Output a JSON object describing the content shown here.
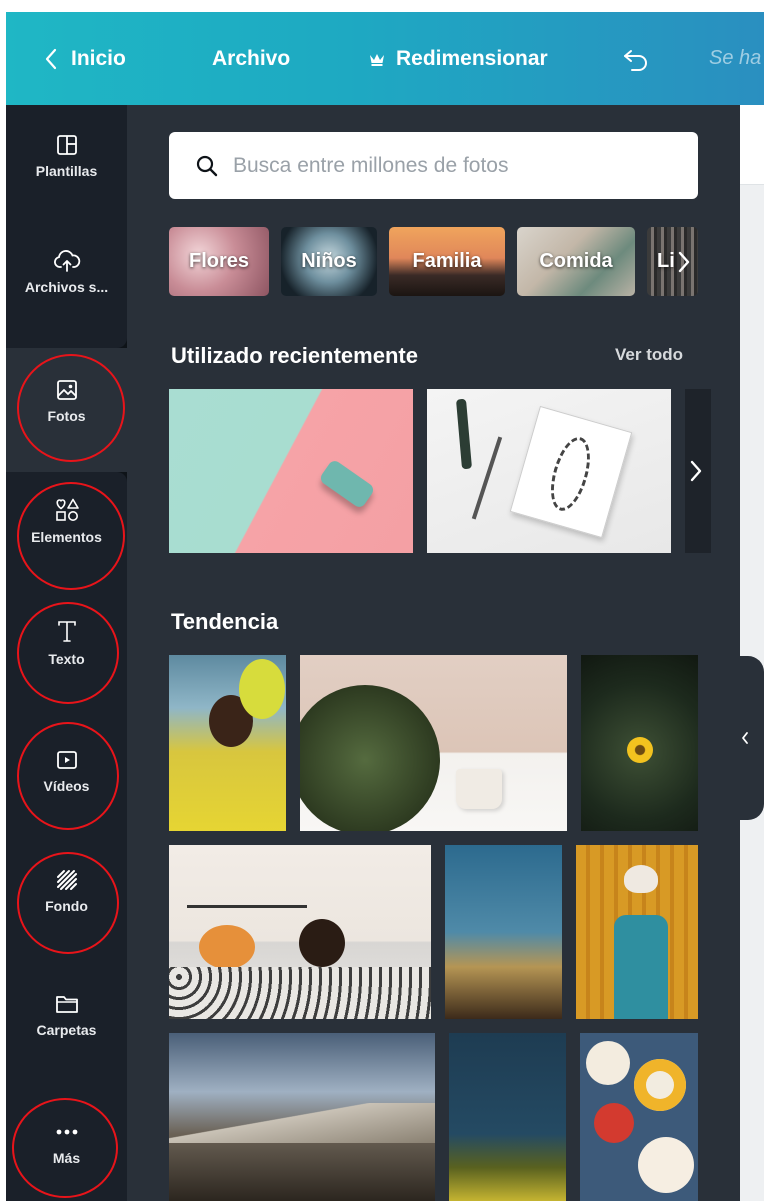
{
  "topbar": {
    "back_label": "Inicio",
    "file_label": "Archivo",
    "resize_label": "Redimensionar",
    "saved_status": "Se ha"
  },
  "sidebar": {
    "items": [
      {
        "label": "Plantillas",
        "icon": "templates-icon"
      },
      {
        "label": "Archivos s...",
        "icon": "upload-cloud-icon"
      },
      {
        "label": "Fotos",
        "icon": "photo-icon"
      },
      {
        "label": "Elementos",
        "icon": "shapes-icon"
      },
      {
        "label": "Texto",
        "icon": "text-icon"
      },
      {
        "label": "Vídeos",
        "icon": "video-icon"
      },
      {
        "label": "Fondo",
        "icon": "background-icon"
      },
      {
        "label": "Carpetas",
        "icon": "folder-icon"
      },
      {
        "label": "Más",
        "icon": "more-icon"
      }
    ],
    "active": "Fotos"
  },
  "panel": {
    "search": {
      "placeholder": "Busca entre millones de fotos"
    },
    "categories": [
      "Flores",
      "Niños",
      "Familia",
      "Comida",
      "Li"
    ],
    "recent": {
      "title": "Utilizado recientemente",
      "see_all": "Ver todo"
    },
    "trending": {
      "title": "Tendencia"
    }
  },
  "colors": {
    "topbar_start": "#1fb7c5",
    "topbar_end": "#2a8fc0",
    "sidebar_bg": "#0e1318",
    "panel_bg": "#293039",
    "highlight_ring": "#e8141a"
  }
}
